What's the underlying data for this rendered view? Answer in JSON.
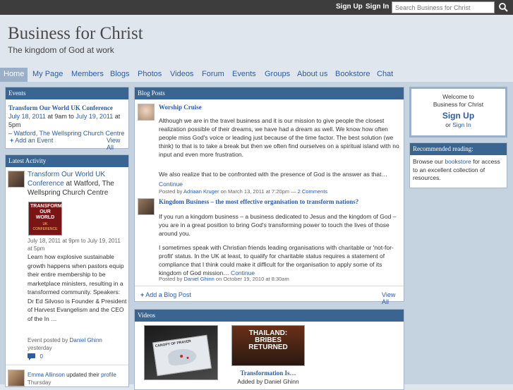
{
  "topbar": {
    "signup": "Sign Up",
    "signin": "Sign In",
    "search_placeholder": "Search Business for Christ"
  },
  "header": {
    "title": "Business for Christ",
    "tagline": "The kingdom of God at work"
  },
  "nav": [
    "Home",
    "My Page",
    "Members",
    "Blogs",
    "Photos",
    "Videos",
    "Forum",
    "Events",
    "Groups",
    "About us",
    "Bookstore",
    "Chat"
  ],
  "events": {
    "heading": "Events",
    "title": "Transform Our World UK Conference",
    "date_start": "July 18, 2011",
    "time_start": " at 9am to ",
    "date_end": "July 19, 2011",
    "time_end": " at 5pm",
    "dash": "– ",
    "location": "Watford, The Wellspring Church Centre",
    "add": "Add an Event",
    "view_all": "View All"
  },
  "activity": {
    "heading": "Latest Activity",
    "item_title": "Transform Our World UK Conference",
    "item_location": " at Watford, The Wellspring Church Centre",
    "poster_lines": [
      "TRANSFORM",
      "OUR WORLD",
      "UK CONFERENCE"
    ],
    "dates": "July 18, 2011 at 9pm to July 19, 2011 at 5pm",
    "description": "Learn how explosive sustainable growth happens when pastors equip their entire membership to be marketplace ministers, resulting in a transformed community. Speakers: Dr Ed Silvoso is Founder & President of Harvest Evangelism and the CEO of the In …",
    "posted_by": "Event posted by ",
    "poster": "Daniel Ghinn",
    "when": "yesterday",
    "comments": "0",
    "next_user": "Emma Allinson",
    "next_action": " updated their ",
    "next_target": "profile",
    "next_when": "Thursday"
  },
  "blog": {
    "heading": "Blog Posts",
    "posts": [
      {
        "title": "Worship Cruise",
        "p1": "Although we are in the travel business and it is our mission to give people the closest realization possible of their dreams, we have had a dream as well. We know how often people miss God's voice or leading just because of the time factor. The best solution (we think) to that is to take a break but then we often find ourselves on a spiritual island with no input and even more frustration.",
        "p2": "We also realize that to be confronted with the presence of God is the answer as that…",
        "continue": "Continue",
        "by": "Posted by ",
        "author": "Adriaan Kruger",
        "meta": " on March 13, 2011 at 7:20pm — ",
        "comments": "2 Comments"
      },
      {
        "title": "Kingdom Business – the most effective organisation to transform nations?",
        "p1": "If you run a kingdom business – a business dedicated to Jesus and the kingdom of God – you are in a great position to bring God's transforming power to touch the lives of those around you.",
        "p2": "I sometimes speak with Christian friends leading organisations with charitable or 'not-for-profit' status. In the UK at least, to qualify for charitable status requires a statement of compliance that I think could make it difficult for the organisation to apply some of its kingdom of God mission…",
        "continue": "Continue",
        "by": "Posted by ",
        "author": "Daniel Ghinn",
        "meta": " on October 19, 2010 at 8:30am"
      }
    ],
    "add": "Add a Blog Post",
    "view_all": "View All"
  },
  "videos": {
    "heading": "Videos",
    "v1_thumb_text": "CANOPY OF PRAYER",
    "v2_thumb_line1": "THAILAND:",
    "v2_thumb_line2": "BRIBES",
    "v2_thumb_line3": "RETURNED",
    "v2_title": "Transformation Is…",
    "v2_added": "Added by Daniel Ghinn"
  },
  "welcome": {
    "line1": "Welcome to",
    "line2": "Business for Christ",
    "signup": "Sign Up",
    "or": "or ",
    "signin": "Sign In"
  },
  "reading": {
    "heading": "Recommended reading:",
    "pre": "Browse our ",
    "link": "bookstore",
    "post": " for access to an excellent collection of resources."
  },
  "colors": {
    "topbar": "#3d3d3d",
    "header_bg": "#dfe6ee",
    "box_head": "#3b6591",
    "link": "#2a5da8",
    "content_bg": "#c5d2e0"
  }
}
